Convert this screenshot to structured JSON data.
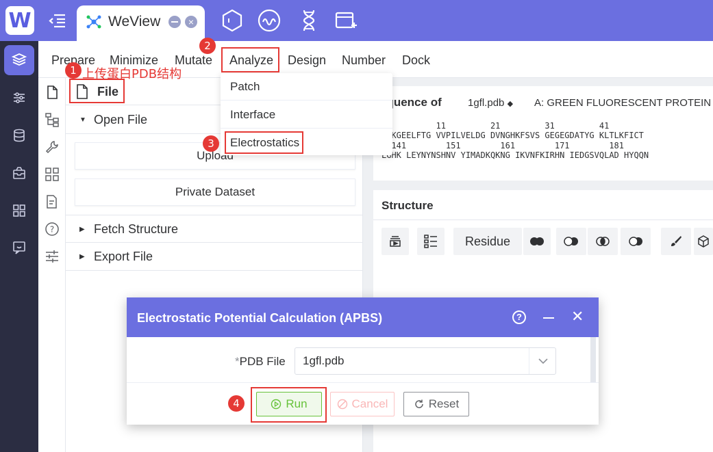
{
  "app": {
    "logo_letter": "W",
    "tab_title": "WeView"
  },
  "menubar": {
    "items": [
      "Prepare",
      "Minimize",
      "Mutate",
      "Analyze",
      "Design",
      "Number",
      "Dock"
    ]
  },
  "analyze_menu": {
    "items": [
      "Patch",
      "Interface",
      "Electrostatics"
    ]
  },
  "file_panel": {
    "title": "File",
    "open_file": "Open File",
    "upload": "Upload",
    "private_dataset": "Private Dataset",
    "fetch_structure": "Fetch Structure",
    "export_file": "Export File"
  },
  "sequence": {
    "title": "equence of",
    "file": "1gfl.pdb",
    "chain": "A: GREEN FLUORESCENT PROTEIN",
    "num_line_1": "           11         21         31         41",
    "seq_line_1": "ASKGEELFTG VVPILVELDG DVNGHKFSVS GEGEGDATYG KLTLKFICT",
    "num_line_2": "  141        151        161        171        181",
    "seq_line_2": "LGHK LEYNYNSHNV YIMADKQKNG IKVNFKIRHN IEDGSVQLAD HYQQN"
  },
  "structure": {
    "title": "Structure",
    "residue_label": "Residue"
  },
  "annotations": {
    "step1_text": "上传蛋白PDB结构",
    "badges": [
      "1",
      "2",
      "3",
      "4"
    ]
  },
  "dialog": {
    "title": "Electrostatic Potential Calculation (APBS)",
    "help": "?",
    "pdb_label": "PDB File",
    "required_mark": "*",
    "pdb_value": "1gfl.pdb",
    "run": "Run",
    "cancel": "Cancel",
    "reset": "Reset"
  },
  "colors": {
    "accent": "#6b6fe0",
    "sidebar": "#2b2d42",
    "annotation": "#e53935",
    "run": "#67c23a"
  }
}
